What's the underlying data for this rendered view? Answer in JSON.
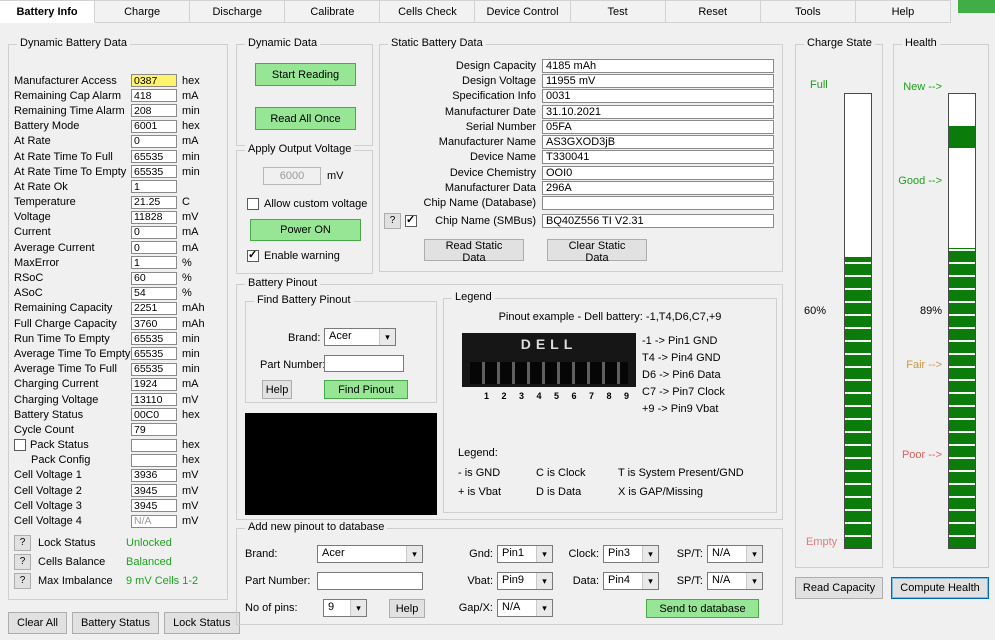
{
  "app": {
    "tabs": [
      {
        "label": "Battery Info",
        "flags": "active"
      },
      {
        "label": "Charge"
      },
      {
        "label": "Discharge"
      },
      {
        "label": "Calibrate"
      },
      {
        "label": "Cells Check"
      },
      {
        "label": "Device Control"
      },
      {
        "label": "Test"
      },
      {
        "label": "Reset"
      },
      {
        "label": "Tools"
      },
      {
        "label": "Help"
      }
    ]
  },
  "icons": {
    "chevron_down": "▾",
    "checkmark": "✓",
    "question": "?"
  },
  "colors": {
    "button_green": "#96e696",
    "bar_green": "#0b7c0b",
    "ok_green": "#1ea11e",
    "fair_orange": "#c8993f",
    "bad_red": "#e06060",
    "highlight_yellow": "#fff36b",
    "accent_green": "#3fae46",
    "default_button_blue": "#0067c0"
  },
  "dynamic": {
    "title": "Dynamic Battery Data",
    "rows": [
      {
        "label": "Manufacturer Access",
        "value": "0387",
        "unit": "hex",
        "flags": "hl"
      },
      {
        "label": "Remaining Cap Alarm",
        "value": "418",
        "unit": "mA"
      },
      {
        "label": "Remaining Time Alarm",
        "value": "208",
        "unit": "min"
      },
      {
        "label": "Battery Mode",
        "value": "6001",
        "unit": "hex"
      },
      {
        "label": "At Rate",
        "value": "0",
        "unit": "mA"
      },
      {
        "label": "At Rate Time To Full",
        "value": "65535",
        "unit": "min"
      },
      {
        "label": "At Rate Time To Empty",
        "value": "65535",
        "unit": "min"
      },
      {
        "label": "At Rate Ok",
        "value": "1",
        "unit": ""
      },
      {
        "label": "Temperature",
        "value": "21.25",
        "unit": "C"
      },
      {
        "label": "Voltage",
        "value": "11828",
        "unit": "mV"
      },
      {
        "label": "Current",
        "value": "0",
        "unit": "mA"
      },
      {
        "label": "Average Current",
        "value": "0",
        "unit": "mA"
      },
      {
        "label": "MaxError",
        "value": "1",
        "unit": "%"
      },
      {
        "label": "RSoC",
        "value": "60",
        "unit": "%"
      },
      {
        "label": "ASoC",
        "value": "54",
        "unit": "%"
      },
      {
        "label": "Remaining Capacity",
        "value": "2251",
        "unit": "mAh"
      },
      {
        "label": "Full Charge Capacity",
        "value": "3760",
        "unit": "mAh"
      },
      {
        "label": "Run Time To Empty",
        "value": "65535",
        "unit": "min"
      },
      {
        "label": "Average Time To Empty",
        "value": "65535",
        "unit": "min"
      },
      {
        "label": "Average Time To Full",
        "value": "65535",
        "unit": "min"
      },
      {
        "label": "Charging Current",
        "value": "1924",
        "unit": "mA"
      },
      {
        "label": "Charging Voltage",
        "value": "13110",
        "unit": "mV"
      },
      {
        "label": "Battery Status",
        "value": "00C0",
        "unit": "hex"
      },
      {
        "label": "Cycle Count",
        "value": "79",
        "unit": ""
      },
      {
        "label": "Pack Status",
        "value": "",
        "unit": "hex",
        "flags": "has-cb"
      },
      {
        "label": "Pack Config",
        "value": "",
        "unit": "hex",
        "flags": "indent"
      },
      {
        "label": "Cell Voltage 1",
        "value": "3936",
        "unit": "mV"
      },
      {
        "label": "Cell Voltage 2",
        "value": "3945",
        "unit": "mV"
      },
      {
        "label": "Cell Voltage 3",
        "value": "3945",
        "unit": "mV"
      },
      {
        "label": "Cell Voltage 4",
        "value": "N/A",
        "unit": "mV",
        "flags": "muted"
      }
    ],
    "status_rows": [
      {
        "q": "?",
        "label": "Lock Status",
        "value": "Unlocked"
      },
      {
        "q": "?",
        "label": "Cells Balance",
        "value": "Balanced"
      },
      {
        "q": "?",
        "label": "Max Imbalance",
        "value": "9 mV Cells 1-2"
      }
    ],
    "buttons": [
      {
        "label": "Clear All"
      },
      {
        "label": "Battery Status"
      },
      {
        "label": "Lock Status"
      }
    ]
  },
  "dynamic_actions": {
    "title": "Dynamic Data",
    "start_button": "Start Reading",
    "read_all_button": "Read All Once"
  },
  "apply_voltage": {
    "title": "Apply Output Voltage",
    "voltage": "6000",
    "unit": "mV",
    "custom_checkbox": "Allow custom voltage",
    "power_button": "Power ON",
    "warning_checkbox": "Enable warning"
  },
  "static": {
    "title": "Static Battery Data",
    "rows": [
      {
        "label": "Design Capacity",
        "value": "4185 mAh"
      },
      {
        "label": "Design Voltage",
        "value": "11955 mV"
      },
      {
        "label": "Specification Info",
        "value": "0031"
      },
      {
        "label": "Manufacturer Date",
        "value": "31.10.2021"
      },
      {
        "label": "Serial Number",
        "value": "05FA"
      },
      {
        "label": "Manufacturer Name",
        "value": "AS3GXOD3jB"
      },
      {
        "label": "Device Name",
        "value": "T330041"
      },
      {
        "label": "Device Chemistry",
        "value": "OOI0"
      },
      {
        "label": "Manufacturer Data",
        "value": "296A"
      },
      {
        "label": "Chip Name (Database)",
        "value": ""
      }
    ],
    "smbus": {
      "q": "?",
      "label": "Chip Name (SMBus)",
      "value": "BQ40Z556 TI V2.31"
    },
    "read_button": "Read Static Data",
    "clear_button": "Clear Static Data"
  },
  "pinout": {
    "title": "Battery Pinout",
    "find": {
      "title": "Find Battery Pinout",
      "brand_label": "Brand:",
      "brand_value": "Acer",
      "part_label": "Part Number:",
      "part_value": "",
      "help_button": "Help",
      "find_button": "Find Pinout"
    },
    "legend": {
      "title": "Legend",
      "example": "Pinout example - Dell battery:  -1,T4,D6,C7,+9",
      "dell_label": "DELL",
      "pin_numbers": "1 2 3 4 5 6 7 8 9",
      "mappings": [
        "-1 -> Pin1 GND",
        "T4 -> Pin4 GND",
        "D6 -> Pin6 Data",
        "C7 -> Pin7 Clock",
        "+9 -> Pin9 Vbat"
      ],
      "legend_label": "Legend:",
      "legend_rows": [
        {
          "a": "- is GND",
          "b": "C is Clock",
          "c": "T is System Present/GND"
        },
        {
          "a": "+ is Vbat",
          "b": "D is Data",
          "c": "X is GAP/Missing"
        }
      ]
    }
  },
  "add_pinout": {
    "title": "Add new pinout to database",
    "brand_label": "Brand:",
    "brand_value": "Acer",
    "part_label": "Part Number:",
    "part_value": "",
    "pins_label": "No of pins:",
    "pins_value": "9",
    "help_button": "Help",
    "gnd_label": "Gnd:",
    "gnd_value": "Pin1",
    "vbat_label": "Vbat:",
    "vbat_value": "Pin9",
    "gapx_label": "Gap/X:",
    "gapx_value": "N/A",
    "clock_label": "Clock:",
    "clock_value": "Pin3",
    "data_label": "Data:",
    "data_value": "Pin4",
    "spt1_label": "SP/T:",
    "spt1_value": "N/A",
    "spt2_label": "SP/T:",
    "spt2_value": "N/A",
    "send_button": "Send to database"
  },
  "charge": {
    "title": "Charge State",
    "full_label": "Full",
    "empty_label": "Empty",
    "percent": "60%",
    "fill": "64%",
    "read_button": "Read Capacity"
  },
  "health": {
    "title": "Health",
    "new_label": "New -->",
    "good_label": "Good -->",
    "fair_label": "Fair -->",
    "poor_label": "Poor -->",
    "percent": "89%",
    "fill": "66%",
    "seg_top": "7%",
    "compute_button": "Compute Health"
  }
}
